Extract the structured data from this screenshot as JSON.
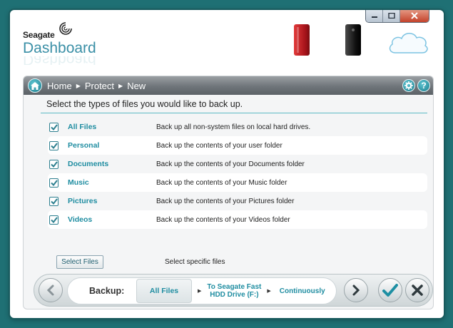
{
  "window": {
    "controls": {
      "minimize": "minimize-icon",
      "maximize": "maximize-icon",
      "close": "close-icon"
    }
  },
  "header": {
    "brand": "Seagate",
    "product": "Dashboard"
  },
  "breadcrumb": {
    "items": [
      "Home",
      "Protect",
      "New"
    ]
  },
  "prompt": "Select the types of files you would like to back up.",
  "file_types": [
    {
      "label": "All Files",
      "description": "Back up all non-system files on local hard drives.",
      "checked": true
    },
    {
      "label": "Personal",
      "description": "Back up the contents of your user folder",
      "checked": true
    },
    {
      "label": "Documents",
      "description": "Back up the contents of your Documents folder",
      "checked": true
    },
    {
      "label": "Music",
      "description": "Back up the contents of your Music folder",
      "checked": true
    },
    {
      "label": "Pictures",
      "description": "Back up the contents of your Pictures folder",
      "checked": true
    },
    {
      "label": "Videos",
      "description": "Back up the contents of your Videos folder",
      "checked": true
    }
  ],
  "select_files": {
    "button_label": "Select Files",
    "description": "Select specific files"
  },
  "summary": {
    "backup_label": "Backup:",
    "files": "All Files",
    "destination_line1": "To Seagate Fast",
    "destination_line2": "HDD Drive (F:)",
    "frequency": "Continuously"
  },
  "colors": {
    "accent": "#1f8da1",
    "background": "#1f7074",
    "confirm": "#1d8fa3"
  }
}
